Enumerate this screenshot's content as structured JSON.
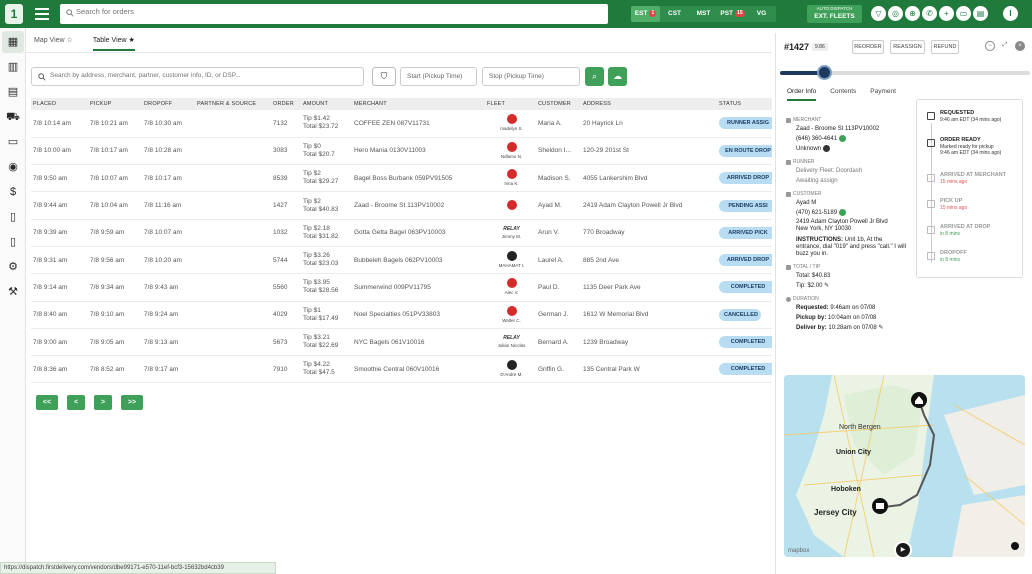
{
  "app": {
    "logo": "1",
    "search_placeholder": "Search for orders",
    "timezones": [
      {
        "label": "EST",
        "badge": "1",
        "active": true
      },
      {
        "label": "CST",
        "badge": "",
        "active": false
      },
      {
        "label": "MST",
        "badge": "",
        "active": false
      },
      {
        "label": "PST",
        "badge": "15",
        "active": false
      },
      {
        "label": "VG",
        "badge": "",
        "active": false
      }
    ],
    "auto_dispatch_small": "AUTO DISPATCH",
    "auto_dispatch_big": "EXT. FLEETS",
    "avatar": "I"
  },
  "sidebar": {
    "icons": [
      "map-icon",
      "chart-icon",
      "calendar-icon",
      "car-icon",
      "ticket-icon",
      "camera-icon",
      "dollar-icon",
      "receipt-icon",
      "receipt-alt-icon",
      "gear-icon",
      "wrench-icon"
    ]
  },
  "views": {
    "map": "Map View",
    "table": "Table View"
  },
  "filters": {
    "search_placeholder": "Search by address, merchant, partner, customer info, ID, or DSP...",
    "start_placeholder": "Start (Pickup Time)",
    "stop_placeholder": "Stop (Pickup Time)"
  },
  "table": {
    "headers": [
      "PLACED",
      "PICKUP",
      "DROPOFF",
      "PARTNER & SOURCE",
      "ORDER",
      "AMOUNT",
      "MERCHANT",
      "FLEET",
      "CUSTOMER",
      "ADDRESS",
      "STATUS"
    ],
    "rows": [
      {
        "placed": "7/8 10:14 am",
        "pickup": "7/8 10:21 am",
        "dropoff": "7/8 10:30 am",
        "order": "7132",
        "tip": "Tip $1.42",
        "total": "Total $23.72",
        "merchant": "COFFEE ZEN 087V11731",
        "fleet": "madelyn S.",
        "fleet_logo": "dd",
        "customer": "Maria A.",
        "address": "20 Hayrick Ln",
        "status": "RUNNER ASSIG"
      },
      {
        "placed": "7/8 10:00 am",
        "pickup": "7/8 10:17 am",
        "dropoff": "7/8 10:28 am",
        "order": "3083",
        "tip": "Tip $0",
        "total": "Total $20.7",
        "merchant": "Hero Mania 0130V11003",
        "fleet": "Ndlamo N.",
        "fleet_logo": "dd",
        "customer": "Sheldon I...",
        "address": "120-29 201st St",
        "status": "EN ROUTE DROP"
      },
      {
        "placed": "7/8 9:50 am",
        "pickup": "7/8 10:07 am",
        "dropoff": "7/8 10:17 am",
        "order": "8539",
        "tip": "Tip $2",
        "total": "Total $29.27",
        "merchant": "Bagel Boss Burbank 059PV91505",
        "fleet": "Irina K.",
        "fleet_logo": "dd",
        "customer": "Madison S.",
        "address": "4055 Lankershim Blvd",
        "status": "ARRIVED DROP"
      },
      {
        "placed": "7/8 9:44 am",
        "pickup": "7/8 10:04 am",
        "dropoff": "7/8 11:16 am",
        "order": "1427",
        "tip": "Tip $2",
        "total": "Total $40.83",
        "merchant": "Zaad - Broome St 113PV10002",
        "fleet": "",
        "fleet_logo": "dd",
        "customer": "Ayad M.",
        "address": "2419 Adam Clayton Powell Jr Blvd",
        "status": "PENDING ASSI"
      },
      {
        "placed": "7/8 9:39 am",
        "pickup": "7/8 9:59 am",
        "dropoff": "7/8 10:07 am",
        "order": "1032",
        "tip": "Tip $2.18",
        "total": "Total $31.82",
        "merchant": "Gotta Getta Bagel 063PV10003",
        "fleet": "Jimmy M.",
        "fleet_logo": "relay",
        "customer": "Arun V.",
        "address": "770 Broadway",
        "status": "ARRIVED PICK"
      },
      {
        "placed": "7/8 9:31 am",
        "pickup": "7/8 9:56 am",
        "dropoff": "7/8 10:20 am",
        "order": "5744",
        "tip": "Tip $3.26",
        "total": "Total $23.03",
        "merchant": "Bubbeleh Bagels 062PV10003",
        "fleet": "MAHAMAT I.",
        "fleet_logo": "dark",
        "customer": "Laurel A.",
        "address": "885 2nd Ave",
        "status": "ARRIVED DROP"
      },
      {
        "placed": "7/8 9:14 am",
        "pickup": "7/8 9:34 am",
        "dropoff": "7/8 9:43 am",
        "order": "5560",
        "tip": "Tip $3.95",
        "total": "Total $28.56",
        "merchant": "Summerwind 009PV11795",
        "fleet": "Alec V.",
        "fleet_logo": "dd",
        "customer": "Paul D.",
        "address": "1135 Deer Park Ave",
        "status": "COMPLETED"
      },
      {
        "placed": "7/8 8:40 am",
        "pickup": "7/8 9:10 am",
        "dropoff": "7/8 9:24 am",
        "order": "4029",
        "tip": "Tip $1",
        "total": "Total $17.49",
        "merchant": "Noel Specialties 051PV33803",
        "fleet": "Walter C.",
        "fleet_logo": "dd",
        "customer": "German J.",
        "address": "1612 W Memorial Blvd",
        "status": "CANCELLED"
      },
      {
        "placed": "7/8 9:00 am",
        "pickup": "7/8 9:05 am",
        "dropoff": "7/8 9:13 am",
        "order": "5673",
        "tip": "Tip $3.21",
        "total": "Total $22.69",
        "merchant": "NYC Bagels 061V10016",
        "fleet": "Julian Nicolas",
        "fleet_logo": "relay",
        "customer": "Bernard A.",
        "address": "1239 Broadway",
        "status": "COMPLETED"
      },
      {
        "placed": "7/8 8:36 am",
        "pickup": "7/8 8:52 am",
        "dropoff": "7/8 9:17 am",
        "order": "7910",
        "tip": "Tip $4.22",
        "total": "Total $47.5",
        "merchant": "Smoothie Central 060V10016",
        "fleet": "D'Andre M.",
        "fleet_logo": "dark",
        "customer": "Griffin G.",
        "address": "135 Central Park W",
        "status": "COMPLETED"
      }
    ]
  },
  "pager": [
    "<<",
    "<",
    ">",
    ">>"
  ],
  "status_url": "https://dispatch.firstdelivery.com/vendors/dbe99171-e570-11ef-bcf3-15632bd4cb39",
  "detail": {
    "order_id": "#1427",
    "score": "9.86",
    "buttons": [
      "REORDER",
      "REASSIGN",
      "REFUND"
    ],
    "progress": 0.18,
    "tabs": [
      "Order Info",
      "Contents",
      "Payment"
    ],
    "merchant_label": "MERCHANT",
    "merchant_name": "Zaad - Broome St 113PV10002",
    "merchant_phone": "(646) 360-4641",
    "merchant_status": "Unknown",
    "runner_label": "RUNNER",
    "runner_fleet": "Delivery Fleet: Doordash",
    "runner_status": "Awaiting assign",
    "customer_label": "CUSTOMER",
    "customer_name": "Ayad M",
    "customer_phone": "(470) 621-5189",
    "customer_addr1": "2419 Adam Clayton Powell Jr Blvd",
    "customer_addr2": "New York, NY 10030",
    "instructions_label": "INSTRUCTIONS:",
    "instructions": "Unit 1b, At the entrance, dial \"019\" and press \"call.\" I will buzz you in.",
    "total_label": "TOTAL / TIP",
    "total": "Total: $40.83",
    "tip": "Tip: $2.00",
    "duration_label": "DURATION",
    "requested_label": "Requested:",
    "requested": "9:46am on 07/08",
    "pickup_label": "Pickup by:",
    "pickup": "10:04am on 07/08",
    "deliver_label": "Deliver by:",
    "deliver": "10:28am on 07/08",
    "timeline": [
      {
        "title": "REQUESTED",
        "sub": "9:46 am EDT (34 mins ago)",
        "dim": false,
        "sub_class": ""
      },
      {
        "title": "ORDER READY",
        "sub": "Marked ready for pickup",
        "sub2": "9:46 am EDT (34 mins ago)",
        "dim": false,
        "sub_class": ""
      },
      {
        "title": "ARRIVED AT MERCHANT",
        "sub": "15 mins ago",
        "dim": true,
        "sub_class": "red"
      },
      {
        "title": "PICK UP",
        "sub": "15 mins ago",
        "dim": true,
        "sub_class": "red"
      },
      {
        "title": "ARRIVED AT DROP",
        "sub": "in 8 mins",
        "dim": true,
        "sub_class": "green"
      },
      {
        "title": "DROPOFF",
        "sub": "in 8 mins",
        "dim": true,
        "sub_class": "green"
      }
    ],
    "map": {
      "labels": [
        "North Bergen",
        "Union City",
        "Hoboken",
        "Jersey City"
      ],
      "attribution": "mapbox"
    }
  }
}
